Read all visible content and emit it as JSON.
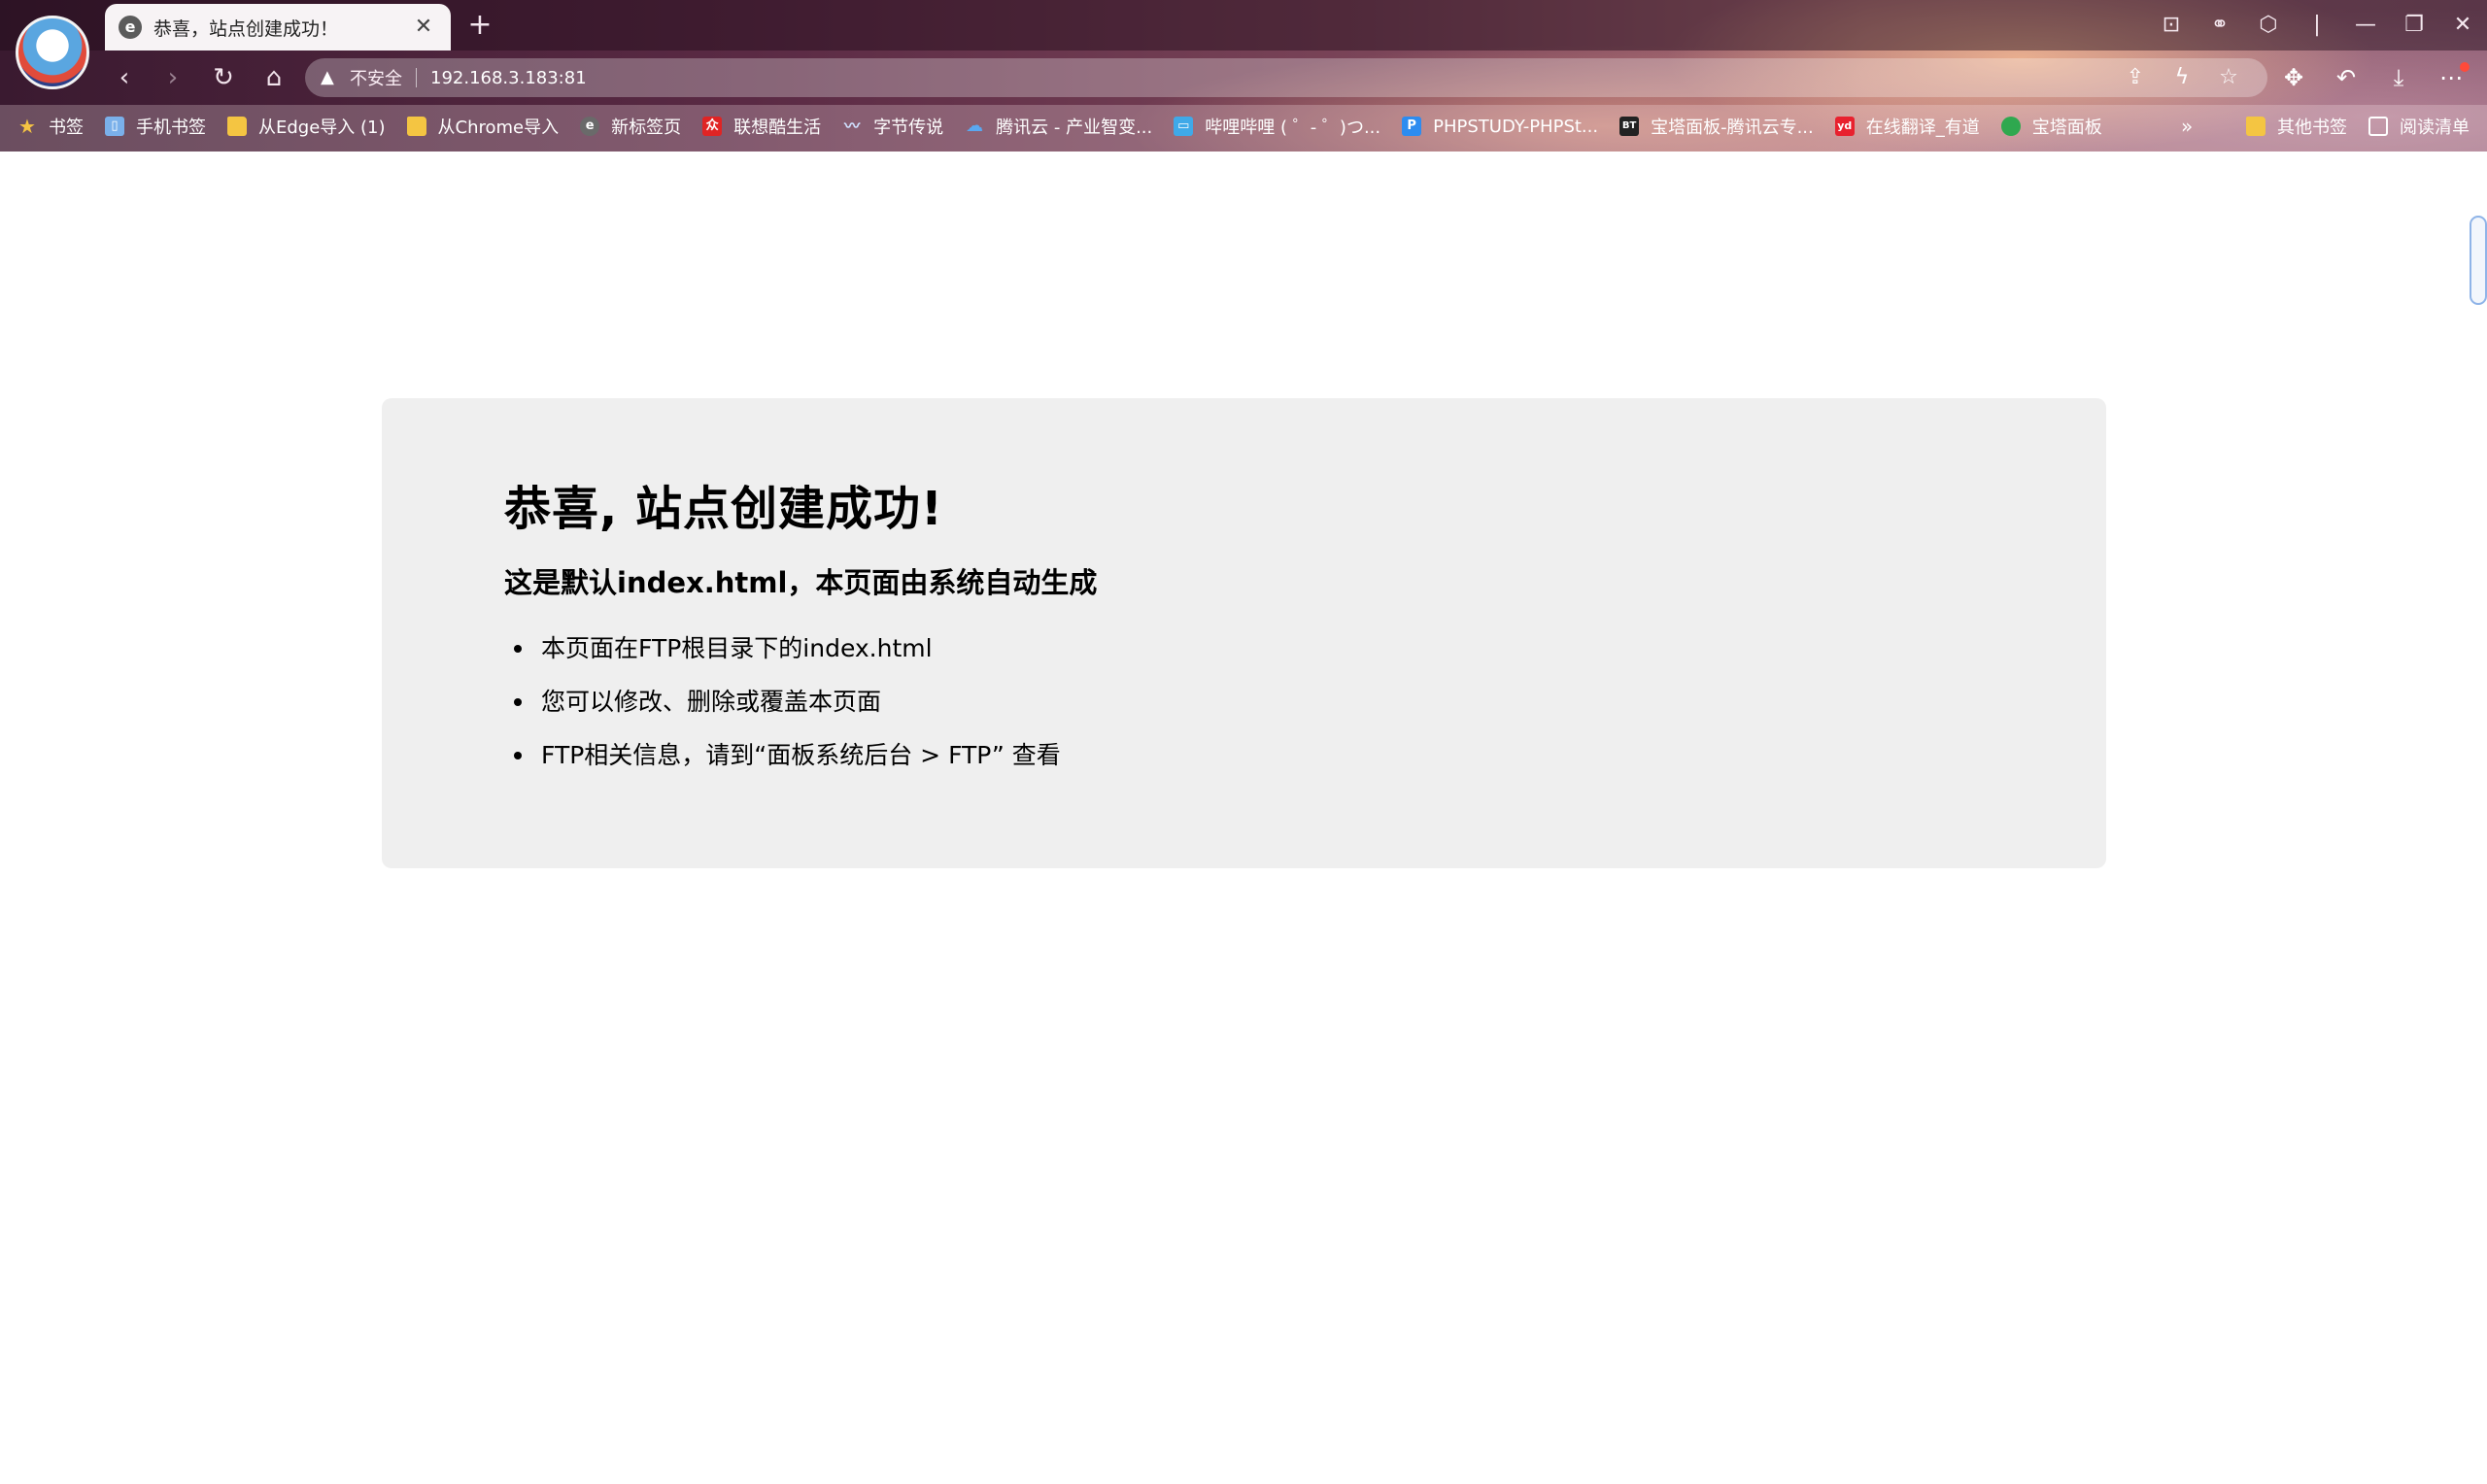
{
  "browser": {
    "tab": {
      "title": "恭喜，站点创建成功！"
    },
    "address_bar": {
      "security_label": "不安全",
      "url": "192.168.3.183:81"
    },
    "bookmarks": [
      {
        "label": "书签",
        "icon": "star-icon"
      },
      {
        "label": "手机书签",
        "icon": "phone-icon"
      },
      {
        "label": "从Edge导入 (1)",
        "icon": "folder-icon"
      },
      {
        "label": "从Chrome导入",
        "icon": "folder-icon"
      },
      {
        "label": "新标签页",
        "icon": "browser-icon"
      },
      {
        "label": "联想酷生活",
        "icon": "lenovo-icon"
      },
      {
        "label": "字节传说",
        "icon": "wave-icon"
      },
      {
        "label": "腾讯云 - 产业智变...",
        "icon": "cloud-icon"
      },
      {
        "label": "哔哩哔哩 ( ゜- ゜)つ...",
        "icon": "tv-icon"
      },
      {
        "label": "PHPSTUDY-PHPSt...",
        "icon": "p-icon"
      },
      {
        "label": "宝塔面板-腾讯云专...",
        "icon": "bt-icon"
      },
      {
        "label": "在线翻译_有道",
        "icon": "youdao-icon"
      },
      {
        "label": "宝塔面板",
        "icon": "green-dot-icon"
      }
    ],
    "bookmarks_more": "»",
    "bookmarks_right": [
      {
        "label": "其他书签",
        "icon": "folder-icon"
      },
      {
        "label": "阅读清单",
        "icon": "reading-list-icon"
      }
    ]
  },
  "page": {
    "heading": "恭喜, 站点创建成功!",
    "subheading": "这是默认index.html，本页面由系统自动生成",
    "items": [
      "本页面在FTP根目录下的index.html",
      "您可以修改、删除或覆盖本页面",
      "FTP相关信息，请到“面板系统后台 > FTP” 查看"
    ]
  }
}
